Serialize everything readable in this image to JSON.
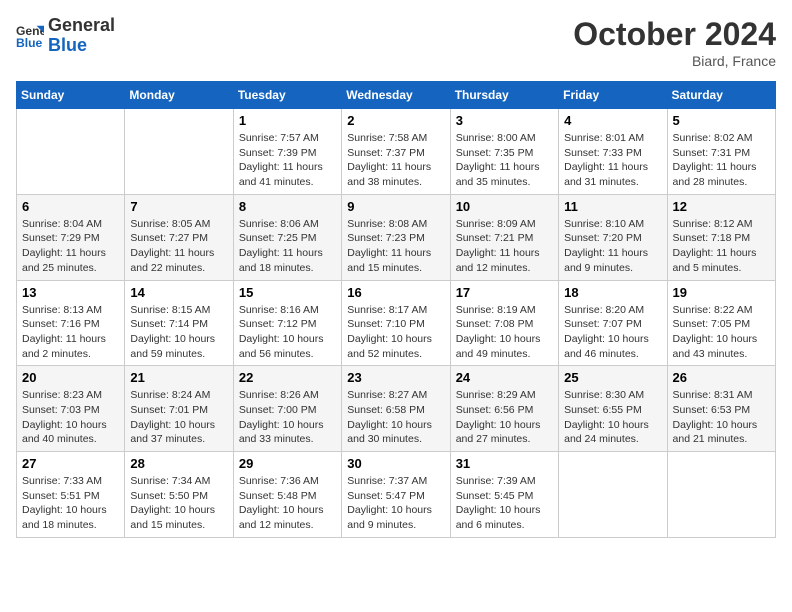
{
  "header": {
    "logo_line1": "General",
    "logo_line2": "Blue",
    "month": "October 2024",
    "location": "Biard, France"
  },
  "weekdays": [
    "Sunday",
    "Monday",
    "Tuesday",
    "Wednesday",
    "Thursday",
    "Friday",
    "Saturday"
  ],
  "weeks": [
    [
      {
        "day": "",
        "info": ""
      },
      {
        "day": "",
        "info": ""
      },
      {
        "day": "1",
        "info": "Sunrise: 7:57 AM\nSunset: 7:39 PM\nDaylight: 11 hours and 41 minutes."
      },
      {
        "day": "2",
        "info": "Sunrise: 7:58 AM\nSunset: 7:37 PM\nDaylight: 11 hours and 38 minutes."
      },
      {
        "day": "3",
        "info": "Sunrise: 8:00 AM\nSunset: 7:35 PM\nDaylight: 11 hours and 35 minutes."
      },
      {
        "day": "4",
        "info": "Sunrise: 8:01 AM\nSunset: 7:33 PM\nDaylight: 11 hours and 31 minutes."
      },
      {
        "day": "5",
        "info": "Sunrise: 8:02 AM\nSunset: 7:31 PM\nDaylight: 11 hours and 28 minutes."
      }
    ],
    [
      {
        "day": "6",
        "info": "Sunrise: 8:04 AM\nSunset: 7:29 PM\nDaylight: 11 hours and 25 minutes."
      },
      {
        "day": "7",
        "info": "Sunrise: 8:05 AM\nSunset: 7:27 PM\nDaylight: 11 hours and 22 minutes."
      },
      {
        "day": "8",
        "info": "Sunrise: 8:06 AM\nSunset: 7:25 PM\nDaylight: 11 hours and 18 minutes."
      },
      {
        "day": "9",
        "info": "Sunrise: 8:08 AM\nSunset: 7:23 PM\nDaylight: 11 hours and 15 minutes."
      },
      {
        "day": "10",
        "info": "Sunrise: 8:09 AM\nSunset: 7:21 PM\nDaylight: 11 hours and 12 minutes."
      },
      {
        "day": "11",
        "info": "Sunrise: 8:10 AM\nSunset: 7:20 PM\nDaylight: 11 hours and 9 minutes."
      },
      {
        "day": "12",
        "info": "Sunrise: 8:12 AM\nSunset: 7:18 PM\nDaylight: 11 hours and 5 minutes."
      }
    ],
    [
      {
        "day": "13",
        "info": "Sunrise: 8:13 AM\nSunset: 7:16 PM\nDaylight: 11 hours and 2 minutes."
      },
      {
        "day": "14",
        "info": "Sunrise: 8:15 AM\nSunset: 7:14 PM\nDaylight: 10 hours and 59 minutes."
      },
      {
        "day": "15",
        "info": "Sunrise: 8:16 AM\nSunset: 7:12 PM\nDaylight: 10 hours and 56 minutes."
      },
      {
        "day": "16",
        "info": "Sunrise: 8:17 AM\nSunset: 7:10 PM\nDaylight: 10 hours and 52 minutes."
      },
      {
        "day": "17",
        "info": "Sunrise: 8:19 AM\nSunset: 7:08 PM\nDaylight: 10 hours and 49 minutes."
      },
      {
        "day": "18",
        "info": "Sunrise: 8:20 AM\nSunset: 7:07 PM\nDaylight: 10 hours and 46 minutes."
      },
      {
        "day": "19",
        "info": "Sunrise: 8:22 AM\nSunset: 7:05 PM\nDaylight: 10 hours and 43 minutes."
      }
    ],
    [
      {
        "day": "20",
        "info": "Sunrise: 8:23 AM\nSunset: 7:03 PM\nDaylight: 10 hours and 40 minutes."
      },
      {
        "day": "21",
        "info": "Sunrise: 8:24 AM\nSunset: 7:01 PM\nDaylight: 10 hours and 37 minutes."
      },
      {
        "day": "22",
        "info": "Sunrise: 8:26 AM\nSunset: 7:00 PM\nDaylight: 10 hours and 33 minutes."
      },
      {
        "day": "23",
        "info": "Sunrise: 8:27 AM\nSunset: 6:58 PM\nDaylight: 10 hours and 30 minutes."
      },
      {
        "day": "24",
        "info": "Sunrise: 8:29 AM\nSunset: 6:56 PM\nDaylight: 10 hours and 27 minutes."
      },
      {
        "day": "25",
        "info": "Sunrise: 8:30 AM\nSunset: 6:55 PM\nDaylight: 10 hours and 24 minutes."
      },
      {
        "day": "26",
        "info": "Sunrise: 8:31 AM\nSunset: 6:53 PM\nDaylight: 10 hours and 21 minutes."
      }
    ],
    [
      {
        "day": "27",
        "info": "Sunrise: 7:33 AM\nSunset: 5:51 PM\nDaylight: 10 hours and 18 minutes."
      },
      {
        "day": "28",
        "info": "Sunrise: 7:34 AM\nSunset: 5:50 PM\nDaylight: 10 hours and 15 minutes."
      },
      {
        "day": "29",
        "info": "Sunrise: 7:36 AM\nSunset: 5:48 PM\nDaylight: 10 hours and 12 minutes."
      },
      {
        "day": "30",
        "info": "Sunrise: 7:37 AM\nSunset: 5:47 PM\nDaylight: 10 hours and 9 minutes."
      },
      {
        "day": "31",
        "info": "Sunrise: 7:39 AM\nSunset: 5:45 PM\nDaylight: 10 hours and 6 minutes."
      },
      {
        "day": "",
        "info": ""
      },
      {
        "day": "",
        "info": ""
      }
    ]
  ]
}
